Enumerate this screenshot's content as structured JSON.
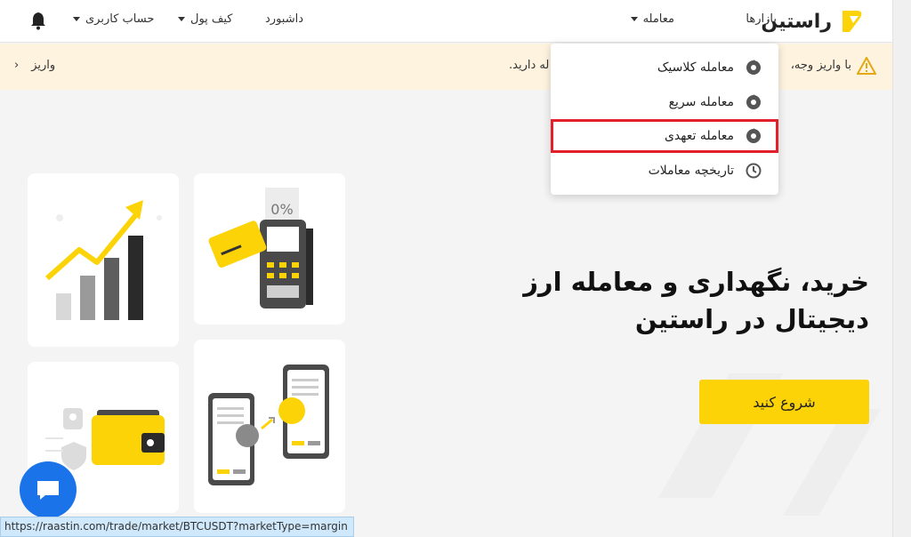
{
  "topbar": {
    "logo_text": "راستین",
    "nav": {
      "markets": "بازارها",
      "trade": "معامله",
      "dashboard": "داشبورد",
      "wallet": "کیف پول",
      "account": "حساب کاربری"
    }
  },
  "notice": {
    "text_right": "با واریز وجه،",
    "text_middle": "له دارید.",
    "link": "واریز"
  },
  "dropdown": {
    "items": [
      {
        "label": "معامله کلاسیک",
        "icon": "trade-icon"
      },
      {
        "label": "معامله سریع",
        "icon": "trade-icon"
      },
      {
        "label": "معامله تعهدی",
        "icon": "trade-icon",
        "highlighted": true
      },
      {
        "label": "تاریخچه معاملات",
        "icon": "history-icon"
      }
    ]
  },
  "hero": {
    "title_line1": "خرید، نگهداری و معامله ارز",
    "title_line2": "دیجیتال در راستین",
    "cta": "شروع کنید"
  },
  "cards": {
    "pos_discount": "0%"
  },
  "status_url": "https://raastin.com/trade/market/BTCUSDT?marketType=margin",
  "colors": {
    "brand_yellow": "#fcd307",
    "notice_bg": "#fdf3df",
    "highlight_red": "#e1202a",
    "chat_blue": "#1a73e8"
  }
}
